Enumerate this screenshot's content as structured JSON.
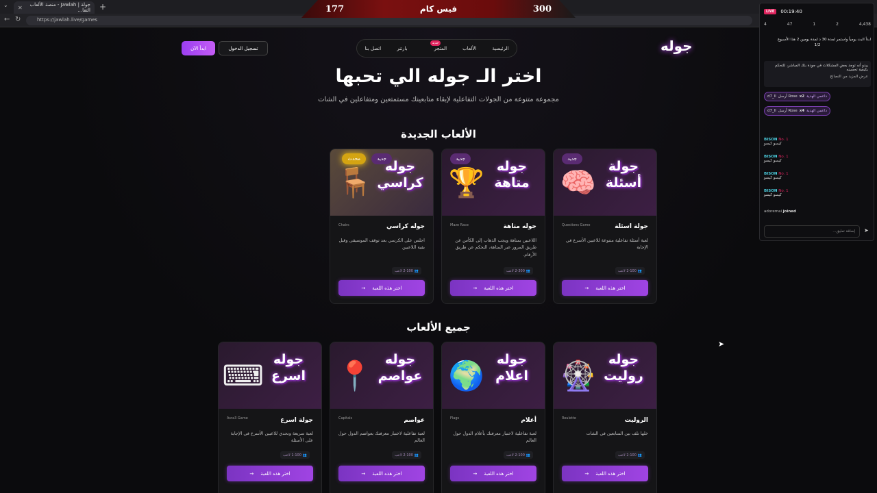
{
  "browser": {
    "tab_title": "جولة | Jawlah - منصة الألعاب التفا...",
    "url": "https://jawlah.live/games"
  },
  "score": {
    "left": "177",
    "label": "فيس كام",
    "right": "300"
  },
  "header": {
    "logo": "جوله",
    "nav": [
      "الرئيسية",
      "الألعاب",
      "المتجر",
      "بارتنر",
      "اتصل بنا"
    ],
    "store_badge": "جديد",
    "login": "تسجيل الدخول",
    "start": "ابدأ الآن"
  },
  "hero": {
    "title": "اختر الـ جوله الي تحبها",
    "subtitle": "مجموعة متنوعة من الجولات التفاعلية لإبقاء متابعينك مستمتعين ومتفاعلين في الشات"
  },
  "sections": {
    "new": "الألعاب الجديدة",
    "all": "جميع الألعاب"
  },
  "choose_label": "اختر هذه اللعبة",
  "new_games": [
    {
      "thumb": "جولة أسئلة",
      "name": "جولة اسئلة",
      "en": "Questions Game",
      "desc": "لعبة أسئلة تفاعلية متنوعة للاعبين الأسرع في الإجابة",
      "players": "2-100 لاعب",
      "chip": "جديد",
      "art": "🧠"
    },
    {
      "thumb": "جوله متاهة",
      "name": "جوله متاهة",
      "en": "Maze Race",
      "desc": "اللاعبين بمتاهة ويجب الذهاب إلى الكأس عن طريق المرور عبر المتاهة، التحكم عن طريق الأرقام.",
      "players": "2-300 لاعب",
      "chip": "جديد",
      "art": "🏆"
    },
    {
      "thumb": "جوله كراسي",
      "name": "جوله كراسي",
      "en": "Chairs",
      "desc": "اجلس على الكرسي بعد توقف الموسيقى وقبل بقية اللاعبين",
      "players": "2-100 لاعب",
      "chip": "جديد",
      "chip2": "محدث",
      "art": "🪑"
    }
  ],
  "all_games": [
    {
      "thumb": "جوله روليت",
      "name": "الروليت",
      "en": "Roulette",
      "desc": "خلها تلف بين المتابعين في الشات",
      "players": "2-100 لاعب",
      "art": "🎡"
    },
    {
      "thumb": "جوله اعلام",
      "name": "أعلام",
      "en": "Flags",
      "desc": "لعبة تفاعلية لاختبار معرفتك بأعلام الدول حول العالم",
      "players": "2-100 لاعب",
      "art": "🌍"
    },
    {
      "thumb": "جوله عواصم",
      "name": "عواصم",
      "en": "Capitals",
      "desc": "لعبة تفاعلية لاختبار معرفتك بعواصم الدول حول العالم",
      "players": "2-100 لاعب",
      "art": "📍"
    },
    {
      "thumb": "جوله اسرع",
      "name": "جولة اسرع",
      "en": "Asra3 Game",
      "desc": "لعبة سريعة وتحدي للاعبين الأسرع في الإجابة على الأسئلة",
      "players": "1-100 لاعب",
      "art": "⌨"
    }
  ],
  "chat": {
    "live": "LIVE",
    "time": "00:19:40",
    "stats": [
      "4",
      "47",
      "1",
      "2",
      "4,438"
    ],
    "poll": "ابدأ البث يومياً واستمر لمدة 30 د لمدة يومين 2 هذا الأسبوع",
    "poll_progress": "1/2",
    "notice": "يبدو أنه توجد بعض المشكلات في جودة بثك المباشر، للتحكم بكيفية تحسينه",
    "notice_link": "عرض المزيد من النصائح",
    "gifts": [
      {
        "user": "d7_ll",
        "text": "أرسل Rose",
        "count": "x2",
        "tag": "داعمي الهدية"
      },
      {
        "user": "d7_ll",
        "text": "أرسل Rose",
        "count": "x4",
        "tag": "داعمي الهدية"
      }
    ],
    "messages": [
      {
        "user": "BISON",
        "rank": "No. 1",
        "text": "كيسو كيسو"
      },
      {
        "user": "BISON",
        "rank": "No. 1",
        "text": "كيسو كيسو"
      },
      {
        "user": "BISON",
        "rank": "No. 1",
        "text": "كيسو كيسو"
      },
      {
        "user": "BISON",
        "rank": "No. 1",
        "text": "كيسو كيسو"
      }
    ],
    "joined_user": "adoremai",
    "joined_text": "joined",
    "input_placeholder": "إضافة تعليق..."
  }
}
